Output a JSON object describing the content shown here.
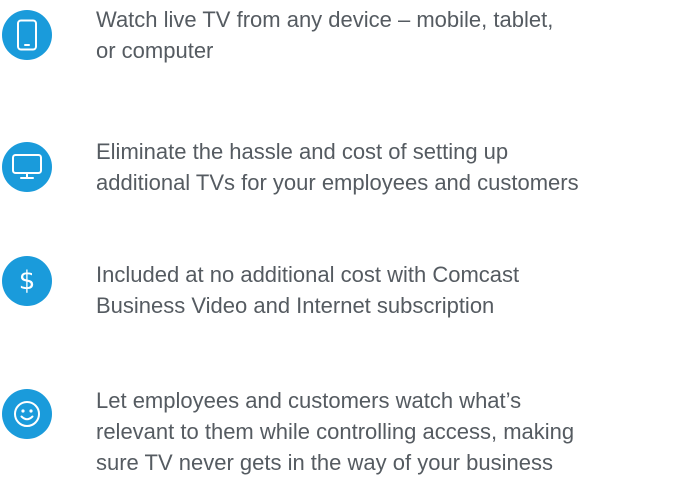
{
  "accent_color": "#1a9bdb",
  "text_color": "#555b61",
  "features": [
    {
      "icon": "mobile-phone-icon",
      "text": "Watch live TV from any device – mobile, tablet,\nor computer"
    },
    {
      "icon": "monitor-icon",
      "text": "Eliminate the hassle and cost of setting up\nadditional TVs for your employees and customers"
    },
    {
      "icon": "dollar-icon",
      "glyph": "$",
      "text": "Included at no additional cost with Comcast\nBusiness Video and Internet subscription"
    },
    {
      "icon": "smiley-face-icon",
      "text": "Let employees and customers watch what’s\nrelevant to them while controlling access, making\nsure TV never gets in the way of your business"
    }
  ]
}
